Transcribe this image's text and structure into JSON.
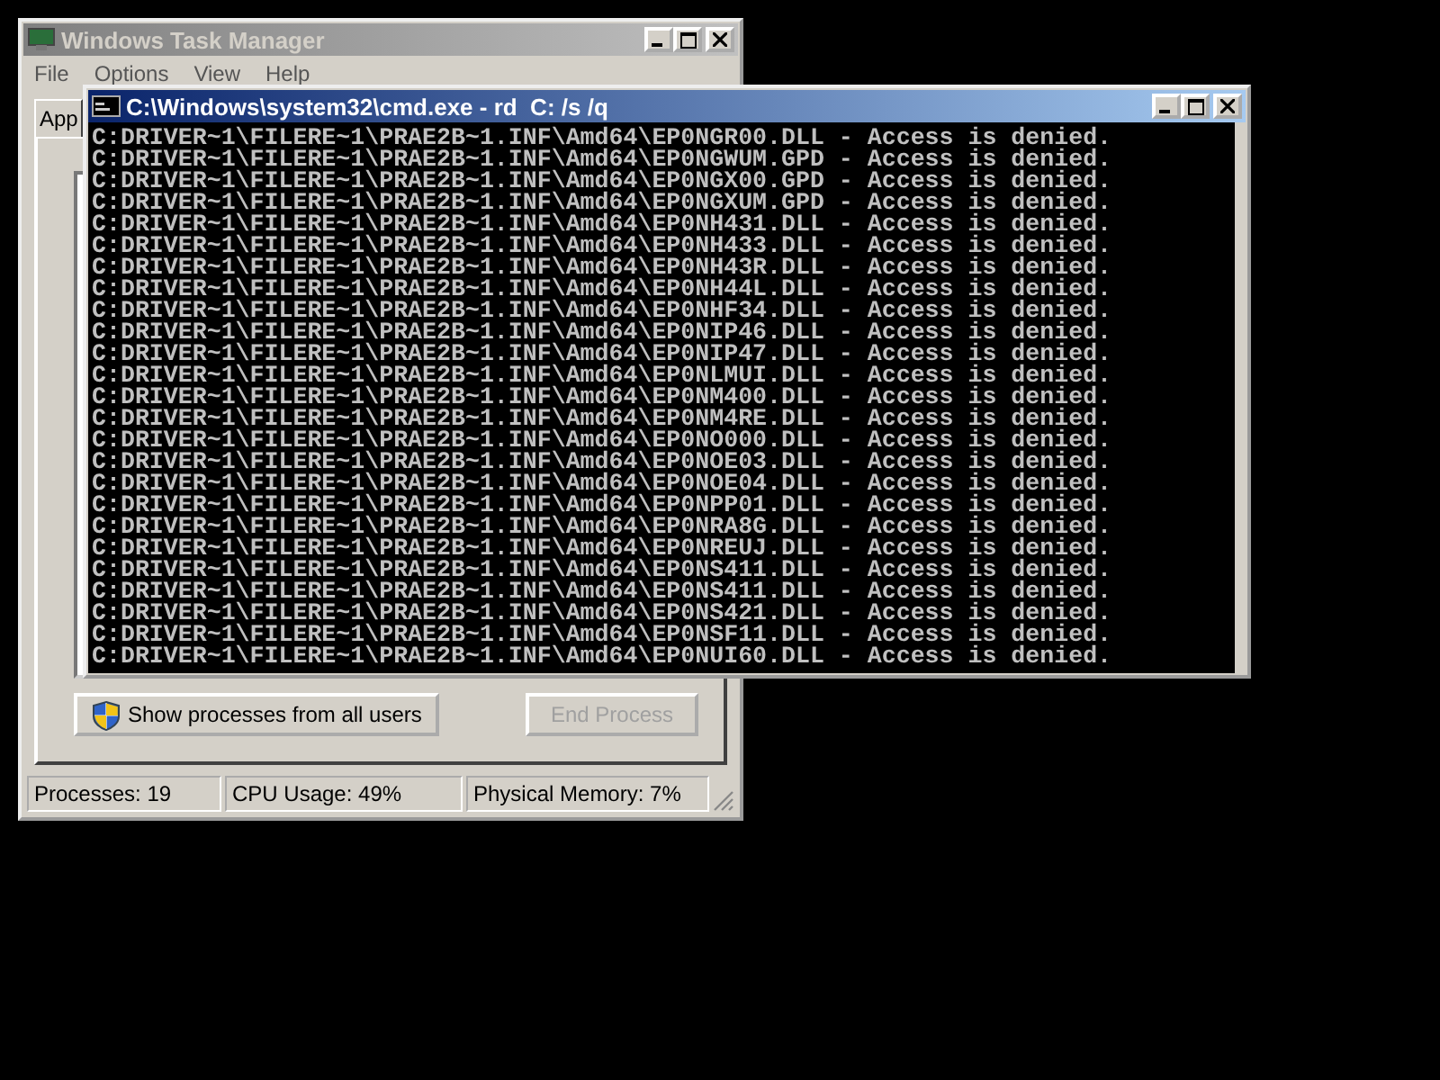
{
  "task_manager": {
    "title": "Windows Task Manager",
    "active": false,
    "menu": [
      "File",
      "Options",
      "View",
      "Help"
    ],
    "tabs": [
      {
        "label": "App",
        "selected": true
      }
    ],
    "buttons": [
      {
        "label": "Show processes from all users",
        "disabled": false
      },
      {
        "label": "End Process",
        "disabled": true
      }
    ],
    "status_bar": [
      "Processes: 19",
      "CPU Usage: 49%",
      "Physical Memory: 7%"
    ]
  },
  "console": {
    "title": "C:\\Windows\\system32\\cmd.exe - rd  C: /s /q",
    "active": true,
    "lines": [
      "C:DRIVER~1\\FILERE~1\\PRAE2B~1.INF\\Amd64\\EP0NGR00.DLL - Access is denied.",
      "C:DRIVER~1\\FILERE~1\\PRAE2B~1.INF\\Amd64\\EP0NGWUM.GPD - Access is denied.",
      "C:DRIVER~1\\FILERE~1\\PRAE2B~1.INF\\Amd64\\EP0NGX00.GPD - Access is denied.",
      "C:DRIVER~1\\FILERE~1\\PRAE2B~1.INF\\Amd64\\EP0NGXUM.GPD - Access is denied.",
      "C:DRIVER~1\\FILERE~1\\PRAE2B~1.INF\\Amd64\\EP0NH431.DLL - Access is denied.",
      "C:DRIVER~1\\FILERE~1\\PRAE2B~1.INF\\Amd64\\EP0NH433.DLL - Access is denied.",
      "C:DRIVER~1\\FILERE~1\\PRAE2B~1.INF\\Amd64\\EP0NH43R.DLL - Access is denied.",
      "C:DRIVER~1\\FILERE~1\\PRAE2B~1.INF\\Amd64\\EP0NH44L.DLL - Access is denied.",
      "C:DRIVER~1\\FILERE~1\\PRAE2B~1.INF\\Amd64\\EP0NHF34.DLL - Access is denied.",
      "C:DRIVER~1\\FILERE~1\\PRAE2B~1.INF\\Amd64\\EP0NIP46.DLL - Access is denied.",
      "C:DRIVER~1\\FILERE~1\\PRAE2B~1.INF\\Amd64\\EP0NIP47.DLL - Access is denied.",
      "C:DRIVER~1\\FILERE~1\\PRAE2B~1.INF\\Amd64\\EP0NLMUI.DLL - Access is denied.",
      "C:DRIVER~1\\FILERE~1\\PRAE2B~1.INF\\Amd64\\EP0NM400.DLL - Access is denied.",
      "C:DRIVER~1\\FILERE~1\\PRAE2B~1.INF\\Amd64\\EP0NM4RE.DLL - Access is denied.",
      "C:DRIVER~1\\FILERE~1\\PRAE2B~1.INF\\Amd64\\EP0NO000.DLL - Access is denied.",
      "C:DRIVER~1\\FILERE~1\\PRAE2B~1.INF\\Amd64\\EP0NOE03.DLL - Access is denied.",
      "C:DRIVER~1\\FILERE~1\\PRAE2B~1.INF\\Amd64\\EP0NOE04.DLL - Access is denied.",
      "C:DRIVER~1\\FILERE~1\\PRAE2B~1.INF\\Amd64\\EP0NPP01.DLL - Access is denied.",
      "C:DRIVER~1\\FILERE~1\\PRAE2B~1.INF\\Amd64\\EP0NRA8G.DLL - Access is denied.",
      "C:DRIVER~1\\FILERE~1\\PRAE2B~1.INF\\Amd64\\EP0NREUJ.DLL - Access is denied.",
      "C:DRIVER~1\\FILERE~1\\PRAE2B~1.INF\\Amd64\\EP0NS411.DLL - Access is denied.",
      "C:DRIVER~1\\FILERE~1\\PRAE2B~1.INF\\Amd64\\EP0NS411.DLL - Access is denied.",
      "C:DRIVER~1\\FILERE~1\\PRAE2B~1.INF\\Amd64\\EP0NS421.DLL - Access is denied.",
      "C:DRIVER~1\\FILERE~1\\PRAE2B~1.INF\\Amd64\\EP0NSF11.DLL - Access is denied.",
      "C:DRIVER~1\\FILERE~1\\PRAE2B~1.INF\\Amd64\\EP0NUI60.DLL - Access is denied."
    ]
  }
}
